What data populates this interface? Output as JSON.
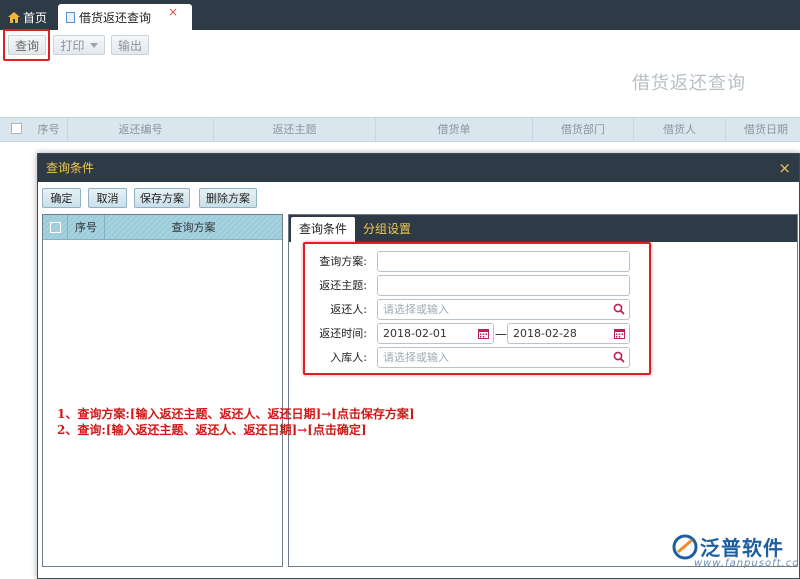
{
  "tabs": {
    "home_label": "首页",
    "active_label": "借货返还查询",
    "close_glyph": "×"
  },
  "toolbar": {
    "query_label": "查询",
    "print_label": "打印",
    "export_label": "输出"
  },
  "page_title": "借货返还查询",
  "grid": {
    "columns": [
      "序号",
      "返还编号",
      "返还主题",
      "借货单",
      "借货部门",
      "借货人",
      "借货日期"
    ]
  },
  "dialog": {
    "title": "查询条件",
    "close_glyph": "×",
    "buttons": [
      "确定",
      "取消",
      "保存方案",
      "删除方案"
    ],
    "left_panel": {
      "columns": [
        "序号",
        "查询方案"
      ]
    },
    "right_panel": {
      "tabs": [
        "查询条件",
        "分组设置"
      ],
      "fields": {
        "scheme_label": "查询方案:",
        "scheme_value": "",
        "subject_label": "返还主题:",
        "subject_value": "",
        "returner_label": "返还人:",
        "returner_placeholder": "请选择或输入",
        "time_label": "返还时间:",
        "time_from": "2018-02-01",
        "time_sep": "—",
        "time_to": "2018-02-28",
        "warehouser_label": "入库人:",
        "warehouser_placeholder": "请选择或输入"
      }
    }
  },
  "notes": {
    "line1": "1、查询方案:[输入返还主题、返还人、返还日期]→[点击保存方案]",
    "line2": "2、查询:[输入返还主题、返还人、返还日期]→[点击确定]"
  },
  "logo": {
    "text": "泛普软件",
    "url": "www.fanpusoft.com"
  },
  "colors": {
    "dark_bar": "#2f3a47",
    "accent_yellow": "#f2c94c",
    "highlight_red": "#e02020",
    "brand_blue": "#1f5fa0"
  }
}
